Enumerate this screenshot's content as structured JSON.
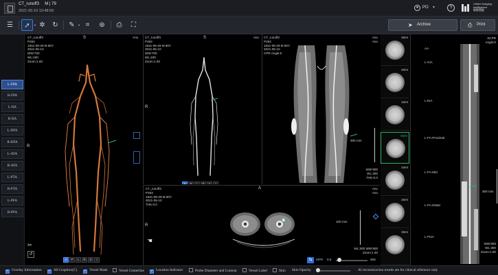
{
  "header": {
    "patient_name": "CT_runoff3",
    "patient_sex_age": "M | 79",
    "study_datetime": "2021-05-10 10:48:59",
    "user_name": "PO",
    "brand_lines": [
      "United Imaging",
      "Intelligence",
      "联影智能"
    ]
  },
  "toolbar": {
    "tools": [
      "list-icon",
      "select-pointer-icon",
      "magic-wand-icon",
      "rotate-icon",
      "pen-icon",
      "measure-icon",
      "vessel-tracking-icon",
      "export-icon",
      "fullscreen-icon"
    ],
    "archive_label": "Archive",
    "print_label": "Print"
  },
  "sidebar": {
    "vessels": [
      "L-FPA",
      "R-FPA",
      "L-IIA",
      "R-IIA",
      "L-DFA",
      "R-DFA",
      "L-ATA",
      "R-ATA",
      "L-PTA",
      "R-PTA",
      "L-PFA",
      "R-PFA"
    ],
    "active_index": 0
  },
  "viewports": {
    "vr": {
      "orient_top": "S",
      "orient_left": "R",
      "direction_buttons": [
        "A",
        "P",
        "L",
        "R",
        "S",
        "I"
      ],
      "active_direction": "A"
    },
    "mip": {
      "info": [
        "CT_runoff3",
        "P263",
        "1941-06-29 M 80Y",
        "2021-05-10",
        "WW:700",
        "WL:400",
        "Zoom:1.00"
      ],
      "tag_right": "Ano",
      "orient_top": "S",
      "orient_left": "R",
      "direction_buttons": [
        "A",
        "P",
        "L",
        "R",
        "S",
        "I"
      ],
      "active_direction": "A"
    },
    "vr_info": {
      "info": [
        "CT_runoff3",
        "P263",
        "1941-06-29 M 80Y",
        "2021-05-10",
        "WW:700",
        "WL:400",
        "Zoom:1.00"
      ],
      "tag_right": "Ano"
    },
    "cpr": {
      "info": [
        "CT_runoff3",
        "P263",
        "1941-06-29 M 80Y",
        "2021-05-10",
        "CPR Angle:0"
      ],
      "tag_right": "Ano",
      "tag_right2": "Ano",
      "scale_label": "300 mm",
      "window": [
        "WW:800",
        "WL:300",
        "THK:0.0"
      ]
    },
    "axial": {
      "info": [
        "CT_runoff3",
        "P263",
        "1941-06-29 M 80Y",
        "2021-05-10",
        "THK:0.0"
      ],
      "tag_right": "Ano",
      "tag_right2": "Ano",
      "orient_top": "A",
      "orient_left": "R",
      "scale_label": "100 mm",
      "window": [
        "WL:300 WW:800",
        "Zoom:1.00"
      ],
      "mpr_label": "MPR",
      "mpr_value": "0.0",
      "mpr_end": "406"
    },
    "cross_sections": [
      "3mm",
      "2mm",
      "1mm",
      "0mm",
      "1mm",
      "2mm",
      "3mm"
    ],
    "cross_selected": 3,
    "scpr": {
      "title": "SCPR",
      "angle": "Angle:0",
      "labels": [
        "AA",
        "L-CIA",
        "L-EIA",
        "L-FA-Proximal",
        "L-FA-Mid",
        "L-FA-Distal",
        "L-POA"
      ],
      "scale_label": "300 mm",
      "window": [
        "WW:800",
        "WL:300",
        "Zoom:1.00"
      ]
    }
  },
  "bottom": {
    "options": [
      {
        "label": "Overlay Information",
        "checked": true
      },
      {
        "label": "All Graphics(C)",
        "checked": true
      },
      {
        "label": "Vessel Mask",
        "checked": true
      },
      {
        "label": "Vessel Centerline",
        "checked": false
      },
      {
        "label": "Location Indicator",
        "checked": true
      },
      {
        "label": "Probe Diameter and Contour",
        "checked": false
      },
      {
        "label": "Vessel Label",
        "checked": false
      },
      {
        "label": "Skin",
        "checked": false
      }
    ],
    "skin_opacity_label": "Skin Opacity",
    "disclaimer": "AI reconstruction results are for clinical reference only"
  },
  "colors": {
    "accent": "#2f6fd8",
    "selected_green": "#2fb56a",
    "vessel_orange": "#d6783a"
  }
}
